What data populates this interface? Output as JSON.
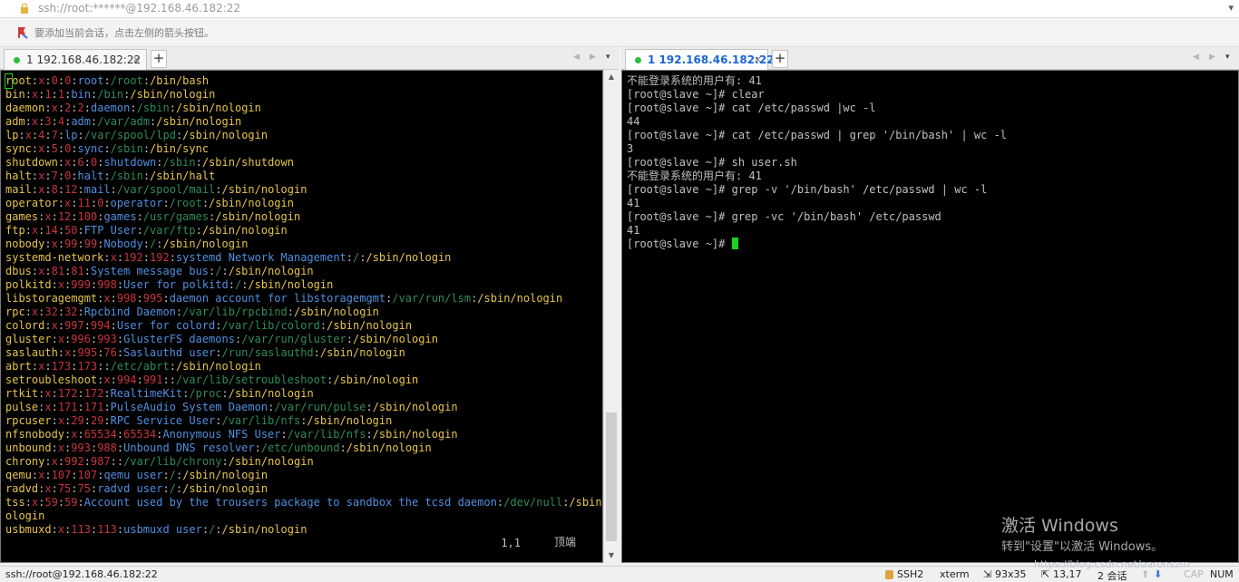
{
  "window": {
    "title": "ssh://root:******@192.168.46.182:22",
    "hint": "要添加当前会话，点击左侧的箭头按钮。"
  },
  "left_pane": {
    "tab": {
      "label": "1 192.168.46.182:22",
      "close": "×",
      "add": "+"
    },
    "passwd_rows": [
      {
        "user": "root",
        "uid": "0",
        "gid": "0",
        "gecos": "root",
        "home": "/root",
        "shell": "/bin/bash"
      },
      {
        "user": "bin",
        "uid": "1",
        "gid": "1",
        "gecos": "bin",
        "home": "/bin",
        "shell": "/sbin/nologin"
      },
      {
        "user": "daemon",
        "uid": "2",
        "gid": "2",
        "gecos": "daemon",
        "home": "/sbin",
        "shell": "/sbin/nologin"
      },
      {
        "user": "adm",
        "uid": "3",
        "gid": "4",
        "gecos": "adm",
        "home": "/var/adm",
        "shell": "/sbin/nologin"
      },
      {
        "user": "lp",
        "uid": "4",
        "gid": "7",
        "gecos": "lp",
        "home": "/var/spool/lpd",
        "shell": "/sbin/nologin"
      },
      {
        "user": "sync",
        "uid": "5",
        "gid": "0",
        "gecos": "sync",
        "home": "/sbin",
        "shell": "/bin/sync"
      },
      {
        "user": "shutdown",
        "uid": "6",
        "gid": "0",
        "gecos": "shutdown",
        "home": "/sbin",
        "shell": "/sbin/shutdown"
      },
      {
        "user": "halt",
        "uid": "7",
        "gid": "0",
        "gecos": "halt",
        "home": "/sbin",
        "shell": "/sbin/halt"
      },
      {
        "user": "mail",
        "uid": "8",
        "gid": "12",
        "gecos": "mail",
        "home": "/var/spool/mail",
        "shell": "/sbin/nologin"
      },
      {
        "user": "operator",
        "uid": "11",
        "gid": "0",
        "gecos": "operator",
        "home": "/root",
        "shell": "/sbin/nologin"
      },
      {
        "user": "games",
        "uid": "12",
        "gid": "100",
        "gecos": "games",
        "home": "/usr/games",
        "shell": "/sbin/nologin"
      },
      {
        "user": "ftp",
        "uid": "14",
        "gid": "50",
        "gecos": "FTP User",
        "home": "/var/ftp",
        "shell": "/sbin/nologin"
      },
      {
        "user": "nobody",
        "uid": "99",
        "gid": "99",
        "gecos": "Nobody",
        "home": "/",
        "shell": "/sbin/nologin"
      },
      {
        "user": "systemd-network",
        "uid": "192",
        "gid": "192",
        "gecos": "systemd Network Management",
        "home": "/",
        "shell": "/sbin/nologin"
      },
      {
        "user": "dbus",
        "uid": "81",
        "gid": "81",
        "gecos": "System message bus",
        "home": "/",
        "shell": "/sbin/nologin"
      },
      {
        "user": "polkitd",
        "uid": "999",
        "gid": "998",
        "gecos": "User for polkitd",
        "home": "/",
        "shell": "/sbin/nologin"
      },
      {
        "user": "libstoragemgmt",
        "uid": "998",
        "gid": "995",
        "gecos": "daemon account for libstoragemgmt",
        "home": "/var/run/lsm",
        "shell": "/sbin/nologin"
      },
      {
        "user": "rpc",
        "uid": "32",
        "gid": "32",
        "gecos": "Rpcbind Daemon",
        "home": "/var/lib/rpcbind",
        "shell": "/sbin/nologin"
      },
      {
        "user": "colord",
        "uid": "997",
        "gid": "994",
        "gecos": "User for colord",
        "home": "/var/lib/colord",
        "shell": "/sbin/nologin"
      },
      {
        "user": "gluster",
        "uid": "996",
        "gid": "993",
        "gecos": "GlusterFS daemons",
        "home": "/var/run/gluster",
        "shell": "/sbin/nologin"
      },
      {
        "user": "saslauth",
        "uid": "995",
        "gid": "76",
        "gecos": "Saslauthd user",
        "home": "/run/saslauthd",
        "shell": "/sbin/nologin"
      },
      {
        "user": "abrt",
        "uid": "173",
        "gid": "173",
        "gecos": "",
        "home": "/etc/abrt",
        "shell": "/sbin/nologin"
      },
      {
        "user": "setroubleshoot",
        "uid": "994",
        "gid": "991",
        "gecos": "",
        "home": "/var/lib/setroubleshoot",
        "shell": "/sbin/nologin"
      },
      {
        "user": "rtkit",
        "uid": "172",
        "gid": "172",
        "gecos": "RealtimeKit",
        "home": "/proc",
        "shell": "/sbin/nologin"
      },
      {
        "user": "pulse",
        "uid": "171",
        "gid": "171",
        "gecos": "PulseAudio System Daemon",
        "home": "/var/run/pulse",
        "shell": "/sbin/nologin"
      },
      {
        "user": "rpcuser",
        "uid": "29",
        "gid": "29",
        "gecos": "RPC Service User",
        "home": "/var/lib/nfs",
        "shell": "/sbin/nologin"
      },
      {
        "user": "nfsnobody",
        "uid": "65534",
        "gid": "65534",
        "gecos": "Anonymous NFS User",
        "home": "/var/lib/nfs",
        "shell": "/sbin/nologin"
      },
      {
        "user": "unbound",
        "uid": "993",
        "gid": "988",
        "gecos": "Unbound DNS resolver",
        "home": "/etc/unbound",
        "shell": "/sbin/nologin"
      },
      {
        "user": "chrony",
        "uid": "992",
        "gid": "987",
        "gecos": "",
        "home": "/var/lib/chrony",
        "shell": "/sbin/nologin"
      },
      {
        "user": "qemu",
        "uid": "107",
        "gid": "107",
        "gecos": "qemu user",
        "home": "/",
        "shell": "/sbin/nologin"
      },
      {
        "user": "radvd",
        "uid": "75",
        "gid": "75",
        "gecos": "radvd user",
        "home": "/",
        "shell": "/sbin/nologin"
      },
      {
        "user": "tss",
        "uid": "59",
        "gid": "59",
        "gecos": "Account used by the trousers package to sandbox the tcsd daemon",
        "home": "/dev/null",
        "shell": "/sbin/nologin"
      },
      {
        "user": "usbmuxd",
        "uid": "113",
        "gid": "113",
        "gecos": "usbmuxd user",
        "home": "/",
        "shell": "/sbin/nologin"
      }
    ],
    "position": "1,1",
    "scroll_label": "顶端"
  },
  "right_pane": {
    "tab": {
      "label": "1 192.168.46.182:22",
      "close": "×",
      "add": "+"
    },
    "lines": [
      "不能登录系统的用户有: 41",
      "[root@slave ~]# clear",
      "[root@slave ~]# cat /etc/passwd |wc -l",
      "44",
      "[root@slave ~]# cat /etc/passwd | grep '/bin/bash' | wc -l",
      "3",
      "[root@slave ~]# sh user.sh",
      "不能登录系统的用户有: 41",
      "[root@slave ~]# grep -v '/bin/bash' /etc/passwd | wc -l",
      "41",
      "[root@slave ~]# grep -vc '/bin/bash' /etc/passwd",
      "41",
      "[root@slave ~]# "
    ]
  },
  "watermark": {
    "line1": "激活 Windows",
    "line2": "转到\"设置\"以激活 Windows。"
  },
  "statusbar": {
    "connection": "ssh://root@192.168.46.182:22",
    "protocol": "SSH2",
    "term": "xterm",
    "size": "93x35",
    "cursor": "13,17",
    "sessions": "2 会话",
    "url": "https://blog.csdn.net/aaronszm",
    "cap": "CAP",
    "num": "NUM"
  },
  "colors": {
    "terminal_bg": "#000000",
    "cursor": "#19d219",
    "tab_active": "#1a66d6"
  }
}
